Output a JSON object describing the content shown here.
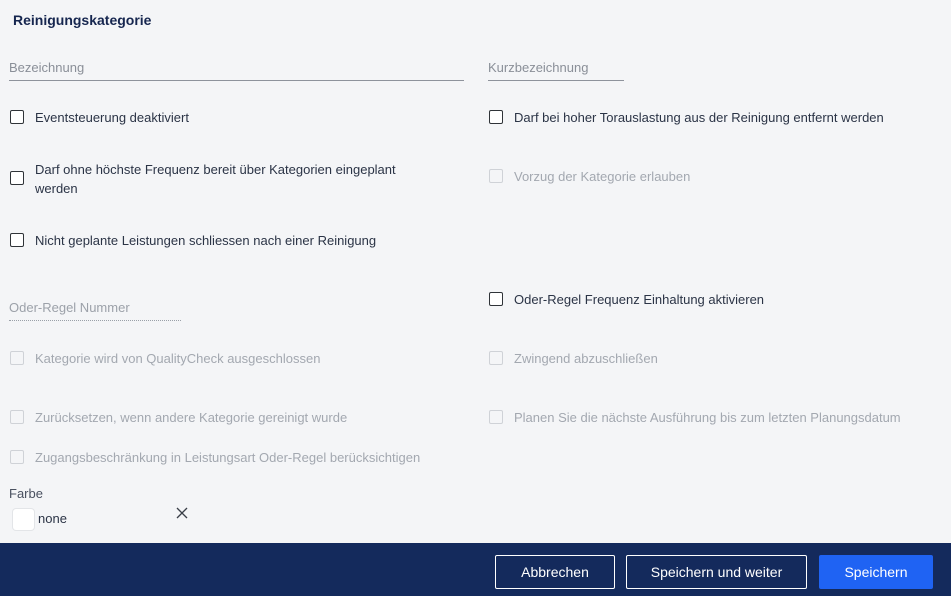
{
  "form": {
    "title": "Reinigungskategorie",
    "bezeichnung_placeholder": "Bezeichnung",
    "kurzbezeichnung_placeholder": "Kurzbezeichnung",
    "oder_regel_nummer_placeholder": "Oder-Regel Nummer"
  },
  "checkboxes": {
    "eventsteuerung": "Eventsteuerung deaktiviert",
    "torauslastung": "Darf bei hoher Torauslastung aus der Reinigung entfernt werden",
    "ohne_frequenz": "Darf ohne höchste Frequenz bereit über Kategorien eingeplant werden",
    "vorzug": "Vorzug der Kategorie erlauben",
    "nicht_geplante": "Nicht geplante Leistungen schliessen nach einer Reinigung",
    "oder_regel_frequenz": "Oder-Regel Frequenz Einhaltung aktivieren",
    "qualitycheck": "Kategorie wird von QualityCheck ausgeschlossen",
    "zwingend": "Zwingend abzuschließen",
    "zuruecksetzen": "Zurücksetzen, wenn andere Kategorie gereinigt wurde",
    "planen": "Planen Sie die nächste Ausführung bis zum letzten Planungsdatum",
    "zugangsbeschraenkung": "Zugangsbeschränkung in Leistungsart Oder-Regel berücksichtigen"
  },
  "color": {
    "label": "Farbe",
    "value": "none",
    "swatch": "#ffffff",
    "clear_icon": "close-icon"
  },
  "footer": {
    "cancel_label": "Abbrechen",
    "save_continue_label": "Speichern und weiter",
    "save_label": "Speichern"
  }
}
